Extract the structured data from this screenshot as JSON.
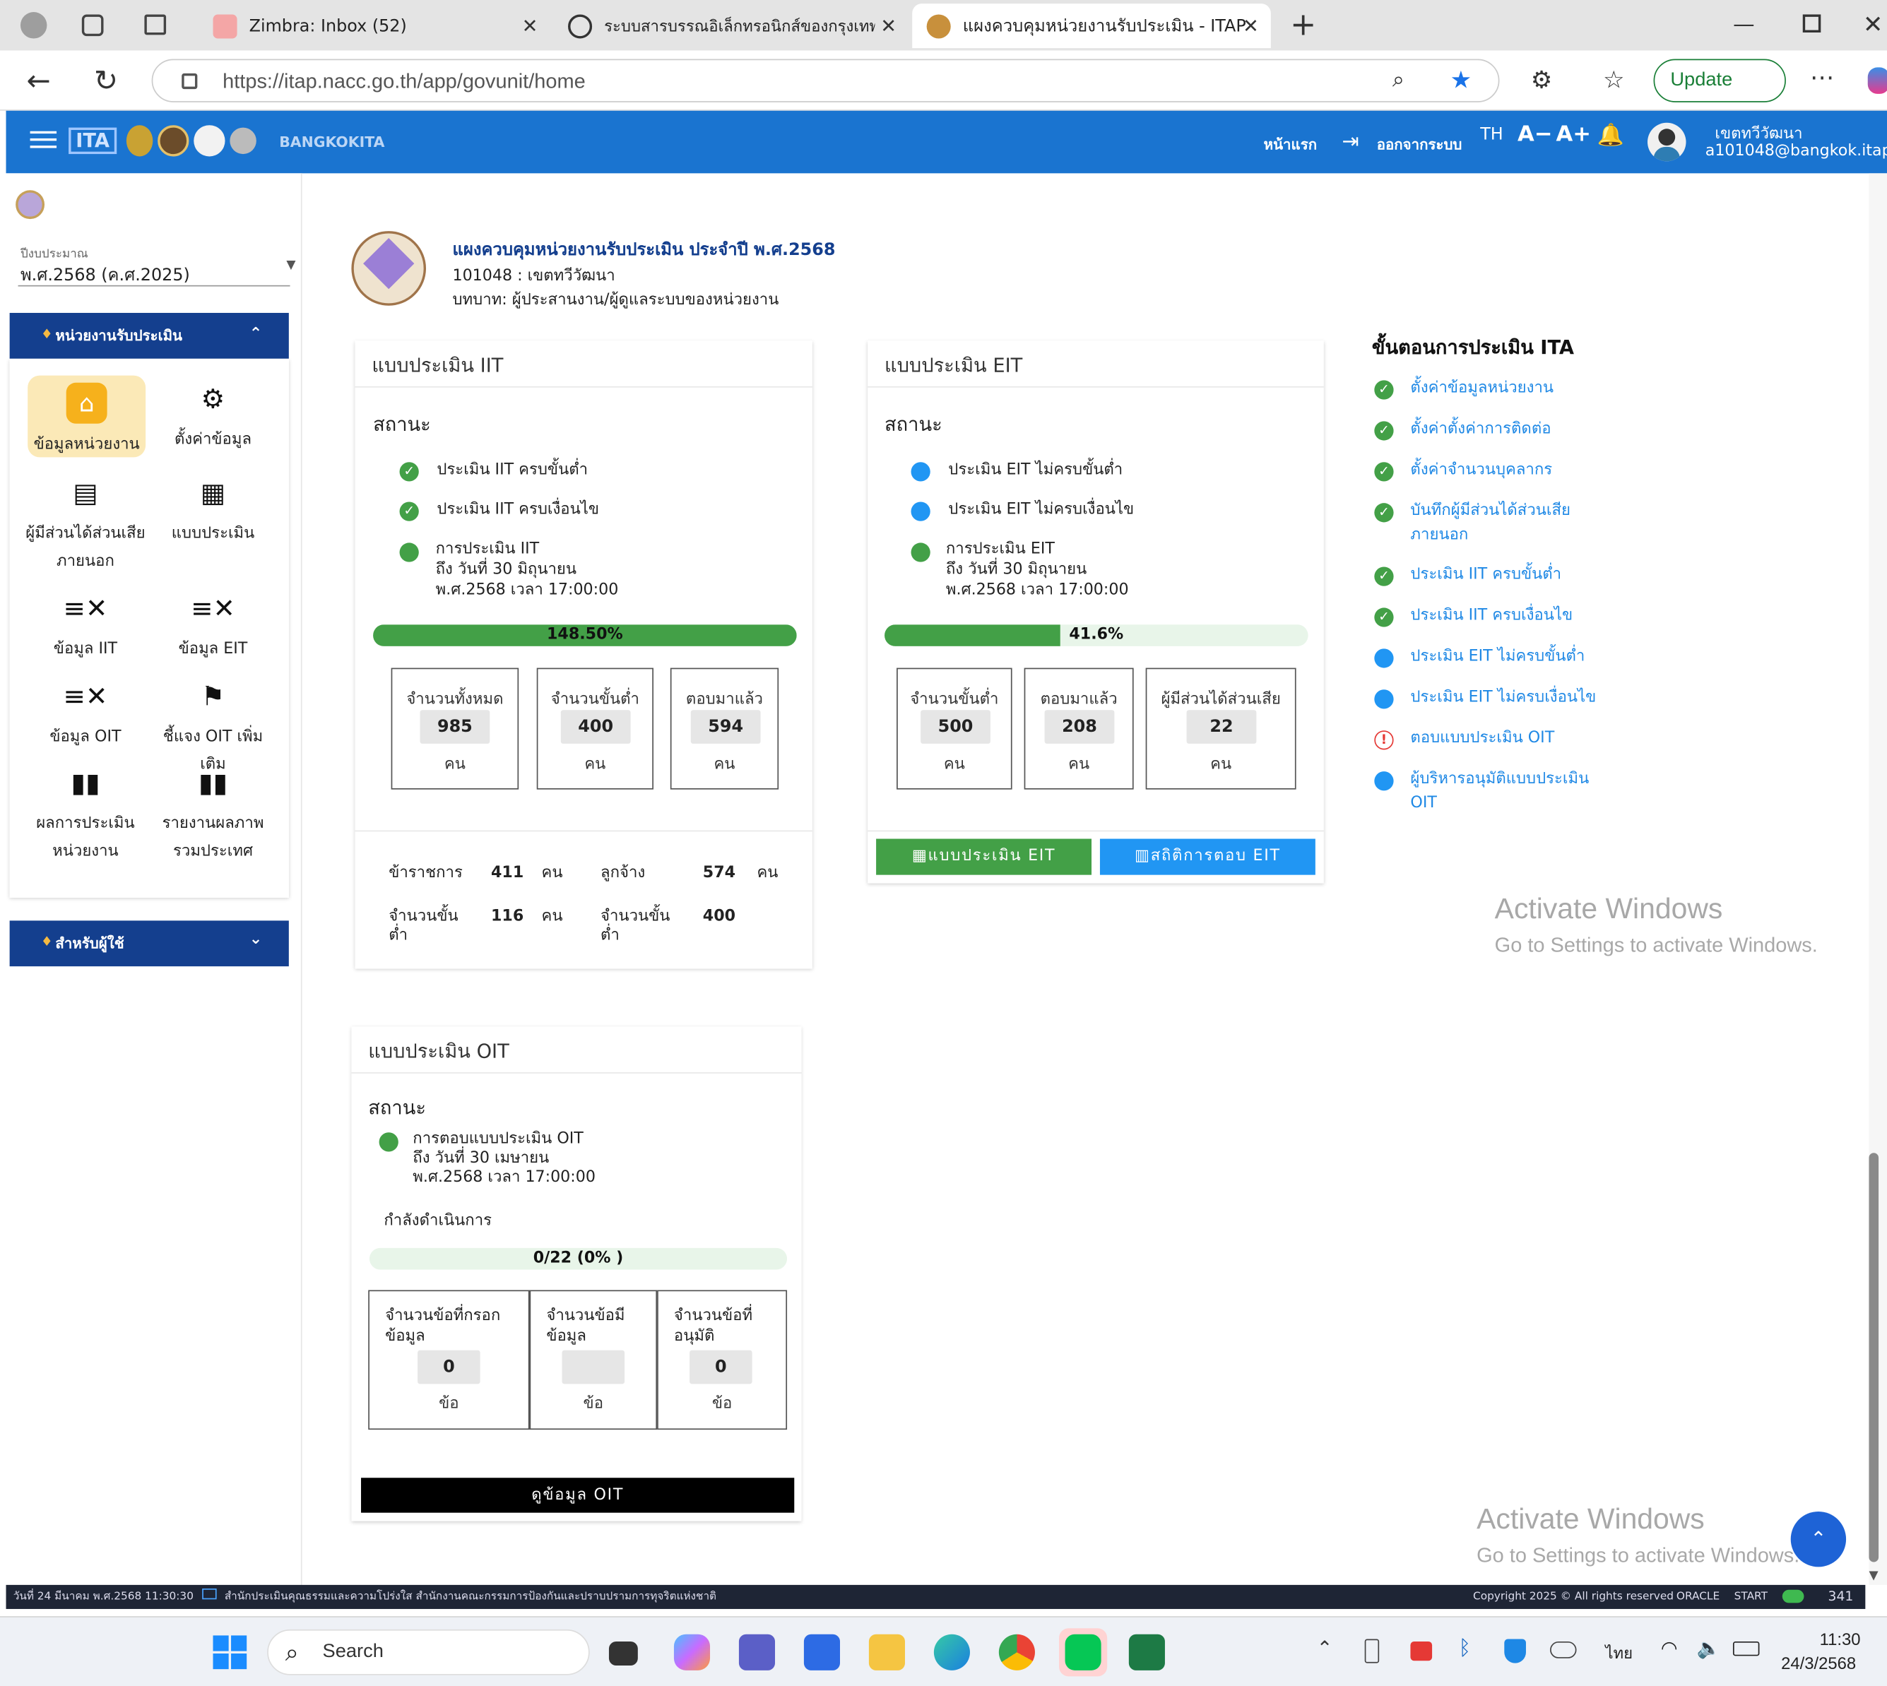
{
  "browser": {
    "tabs": [
      {
        "title": "Zimbra: Inbox (52)"
      },
      {
        "title": "ระบบสารบรรณอิเล็กทรอนิกส์ของกรุงเทพ"
      },
      {
        "title": "แผงควบคุมหน่วยงานรับประเมิน - ITAP"
      }
    ],
    "url": "https://itap.nacc.go.th/app/govunit/home",
    "update_label": "Update",
    "icons": [
      "profile-icon",
      "collections-icon",
      "tab-actions-icon",
      "back-icon",
      "reload-icon",
      "lock-icon",
      "zoom-icon",
      "star-icon",
      "extensions-icon",
      "favorites-icon",
      "more-icon"
    ]
  },
  "header": {
    "brand": "BANGKOKITA",
    "home_label": "หน้าแรก",
    "logout_label": "ออกจากระบบ",
    "lang": "TH",
    "font_smaller": "A−",
    "font_larger": "A+",
    "user_name": "เขตทวีวัฒนา",
    "user_email": "a101048@bangkok.itap",
    "brand_color": "#1a74d0"
  },
  "sidebar": {
    "year_label": "ปีงบประมาณ",
    "year_value": "พ.ศ.2568 (ค.ศ.2025)",
    "section1": "หน่วยงานรับประเมิน",
    "section2": "สำหรับผู้ใช้",
    "items": [
      {
        "label": "ข้อมูลหน่วยงาน",
        "icon": "home-icon",
        "active": true
      },
      {
        "label": "ตั้งค่าข้อมูล",
        "icon": "settings-icon"
      },
      {
        "label": "ผู้มีส่วนได้ส่วนเสีย ภายนอก",
        "icon": "store-icon"
      },
      {
        "label": "แบบประเมิน",
        "icon": "qr-icon"
      },
      {
        "label": "ข้อมูล IIT",
        "icon": "checklist-icon"
      },
      {
        "label": "ข้อมูล EIT",
        "icon": "checklist-icon"
      },
      {
        "label": "ข้อมูล OIT",
        "icon": "checklist-icon"
      },
      {
        "label": "ชี้แจง OIT เพิ่มเติม",
        "icon": "flag-icon"
      },
      {
        "label": "ผลการประเมิน หน่วยงาน",
        "icon": "bar-chart-icon"
      },
      {
        "label": "รายงานผลภาพ รวมประเทศ",
        "icon": "bar-chart-icon"
      }
    ],
    "active_color": "#fbe9b7"
  },
  "page": {
    "title": "แผงควบคุมหน่วยงานรับประเมิน ประจำปี พ.ศ.2568",
    "org": "101048 : เขตทวีวัฒนา",
    "role": "บทบาท: ผู้ประสานงาน/ผู้ดูแลระบบของหน่วยงาน"
  },
  "iit": {
    "title": "แบบประเมิน IIT",
    "status_label": "สถานะ",
    "status": [
      "ประเมิน IIT ครบขั้นต่ำ",
      "ประเมิน IIT ครบเงื่อนไข"
    ],
    "deadline_1": "การประเมิน IIT",
    "deadline_2": "ถึง วันที่ 30 มิถุนายน",
    "deadline_3": "พ.ศ.2568 เวลา 17:00:00",
    "progress_text": "148.50%",
    "progress": 1.0,
    "stats": [
      {
        "label": "จำนวนทั้งหมด",
        "value": "985",
        "unit": "คน"
      },
      {
        "label": "จำนวนขั้นต่ำ",
        "value": "400",
        "unit": "คน"
      },
      {
        "label": "ตอบมาแล้ว",
        "value": "594",
        "unit": "คน"
      }
    ],
    "breakdown": [
      {
        "label": "ข้าราชการ",
        "value": "411",
        "unit": "คน"
      },
      {
        "label": "ลูกจ้าง",
        "value": "574",
        "unit": "คน"
      },
      {
        "label_1": "จำนวนขั้น",
        "label_2": "ต่ำ",
        "value": "116",
        "unit": "คน"
      },
      {
        "label_1": "จำนวนขั้น",
        "label_2": "ต่ำ",
        "value": "400",
        "unit": ""
      }
    ]
  },
  "eit": {
    "title": "แบบประเมิน EIT",
    "status_label": "สถานะ",
    "status": [
      "ประเมิน EIT ไม่ครบขั้นต่ำ",
      "ประเมิน EIT ไม่ครบเงื่อนไข"
    ],
    "deadline_1": "การประเมิน EIT",
    "deadline_2": "ถึง วันที่ 30 มิถุนายน",
    "deadline_3": "พ.ศ.2568 เวลา 17:00:00",
    "progress_text": "41.6%",
    "progress": 0.416,
    "stats": [
      {
        "label": "จำนวนขั้นต่ำ",
        "value": "500",
        "unit": "คน"
      },
      {
        "label": "ตอบมาแล้ว",
        "value": "208",
        "unit": "คน"
      },
      {
        "label": "ผู้มีส่วนได้ส่วนเสีย",
        "value": "22",
        "unit": "คน"
      }
    ],
    "btn_form": "แบบประเมิน EIT",
    "btn_stats": "สถิติการตอบ EIT"
  },
  "oit": {
    "title": "แบบประเมิน OIT",
    "status_label": "สถานะ",
    "deadline_1": "การตอบแบบประเมิน OIT",
    "deadline_2": "ถึง วันที่ 30 เมษายน",
    "deadline_3": "พ.ศ.2568 เวลา 17:00:00",
    "in_progress": "กำลังดำเนินการ",
    "progress_text": "0/22 (0% )",
    "progress": 0,
    "stats": [
      {
        "label_1": "จำนวนข้อที่กรอก",
        "label_2": "ข้อมูล",
        "value": "0",
        "unit": "ข้อ"
      },
      {
        "label_1": "จำนวนข้อมี",
        "label_2": "ข้อมูล",
        "value": "",
        "unit": "ข้อ"
      },
      {
        "label_1": "จำนวนข้อที่",
        "label_2": "อนุมัติ",
        "value": "0",
        "unit": "ข้อ"
      }
    ],
    "btn_view": "ดูข้อมูล OIT"
  },
  "steps": {
    "title": "ขั้นตอนการประเมิน ITA",
    "items": [
      {
        "label": "ตั้งค่าข้อมูลหน่วยงาน",
        "state": "done"
      },
      {
        "label": "ตั้งค่าตั้งค่าการติดต่อ",
        "state": "done"
      },
      {
        "label": "ตั้งค่าจำนวนบุคลากร",
        "state": "done"
      },
      {
        "label_1": "บันทึกผู้มีส่วนได้ส่วนเสีย",
        "label_2": "ภายนอก",
        "state": "done"
      },
      {
        "label": "ประเมิน IIT ครบขั้นต่ำ",
        "state": "done"
      },
      {
        "label": "ประเมิน IIT ครบเงื่อนไข",
        "state": "done"
      },
      {
        "label": "ประเมิน EIT ไม่ครบขั้นต่ำ",
        "state": "pending"
      },
      {
        "label": "ประเมิน EIT ไม่ครบเงื่อนไข",
        "state": "pending"
      },
      {
        "label": "ตอบแบบประเมิน OIT",
        "state": "alert"
      },
      {
        "label_1": "ผู้บริหารอนุมัติแบบประเมิน",
        "label_2": "OIT",
        "state": "pending"
      }
    ]
  },
  "watermark": {
    "line1": "Activate Windows",
    "line2": "Go to Settings to activate Windows."
  },
  "statusline": {
    "left": "วันที่ 24 มีนาคม พ.ศ.2568 11:30:30",
    "center": "สำนักประเมินคุณธรรมและความโปร่งใส สำนักงานคณะกรรมการป้องกันและปราบปรามการทุจริตแห่งชาติ",
    "copyright": "Copyright 2025 © All rights reserved",
    "oracle": "ORACLE",
    "start": "START",
    "count": "341"
  },
  "taskbar": {
    "search": "Search",
    "lang": "ไทย",
    "time": "11:30",
    "date": "24/3/2568"
  },
  "colors": {
    "green": "#43a047",
    "blue": "#2196f3",
    "navy": "#143f8e",
    "red": "#e53935"
  }
}
